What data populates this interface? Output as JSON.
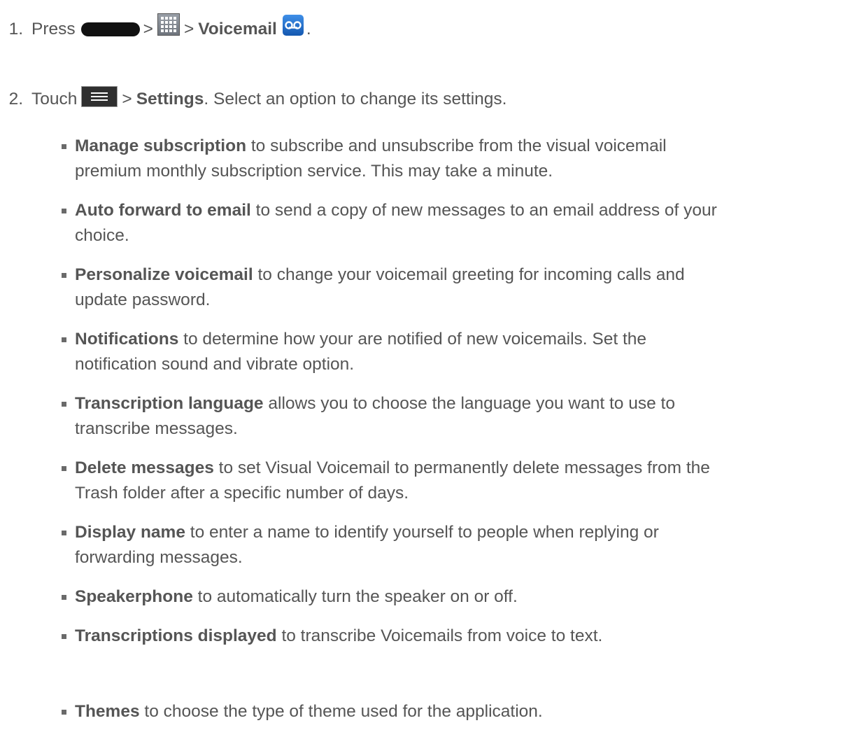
{
  "steps": [
    {
      "number": "1.",
      "press": "Press",
      "sep1": ">",
      "sep2": ">",
      "target": "Voicemail",
      "end": ".",
      "icons": [
        "home-button-icon",
        "apps-icon",
        "voicemail-icon"
      ]
    },
    {
      "number": "2.",
      "touch": "Touch",
      "sep1": ">",
      "target": "Settings",
      "rest": ". Select an option to change its settings.",
      "icons": [
        "menu-button-icon"
      ]
    }
  ],
  "options": [
    {
      "term": "Manage subscription",
      "line1": " to subscribe and unsubscribe from the visual voicemail",
      "line2": "premium monthly subscription service. This may take a minute."
    },
    {
      "term": "Auto forward to email",
      "line1": " to send a copy of new messages to an email address of your",
      "line2": "choice."
    },
    {
      "term": "Personalize voicemail",
      "line1": " to change your voicemail greeting for incoming calls and",
      "line2": "update password."
    },
    {
      "term": "Notifications",
      "line1": " to determine how your are notified of new voicemails. Set the",
      "line2": "notification sound and vibrate option."
    },
    {
      "term": "Transcription language",
      "line1": " allows you to choose the language you want to use to",
      "line2": "transcribe messages."
    },
    {
      "term": "Delete messages",
      "line1": " to set Visual Voicemail to permanently delete messages from the",
      "line2": "Trash folder after a specific number of days."
    },
    {
      "term": "Display name",
      "line1": " to enter a name to identify yourself to people when replying or",
      "line2": "forwarding messages."
    },
    {
      "term": "Speakerphone",
      "line1": " to automatically turn the speaker on or off.",
      "line2": ""
    },
    {
      "term": "Transcriptions displayed",
      "line1": " to transcribe Voicemails from voice to text.",
      "line2": ""
    },
    {
      "term": "Themes",
      "line1": " to choose the type of theme used for the application.",
      "line2": ""
    }
  ]
}
